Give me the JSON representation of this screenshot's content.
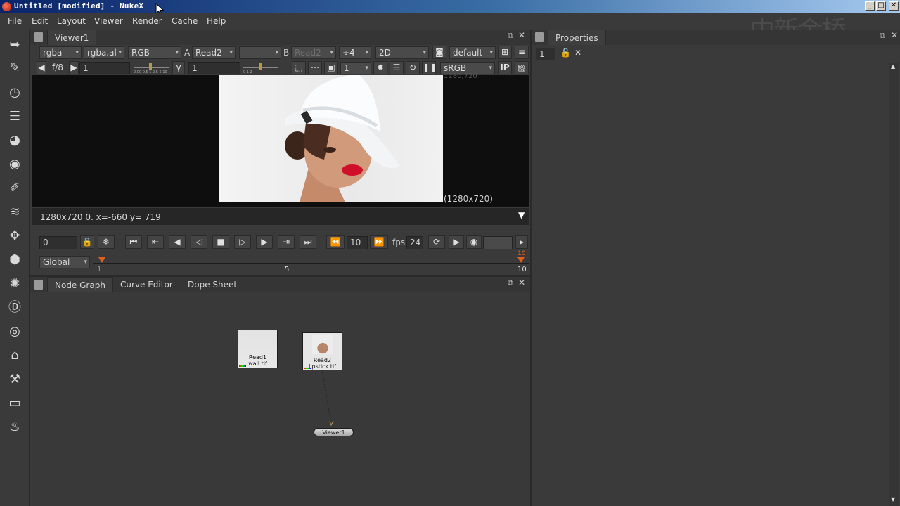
{
  "window": {
    "title": "Untitled [modified] - NukeX",
    "min": "_",
    "max": "□",
    "close": "✕"
  },
  "menu": [
    "File",
    "Edit",
    "Layout",
    "Viewer",
    "Render",
    "Cache",
    "Help"
  ],
  "viewer": {
    "tab": "Viewer1",
    "channels": "rgba",
    "alpha": "rgba.al",
    "display": "RGB",
    "a_label": "A",
    "a_input": "Read2",
    "op": "-",
    "b_label": "B",
    "b_input": "Read2",
    "proxy": "÷4",
    "mode": "2D",
    "lut_default": "default",
    "fstop": "f/8",
    "gain": "1",
    "gamma_label": "γ",
    "gamma": "1",
    "slider_ticks": "0.00 0.5 1 2.5 5 10",
    "gamma_ticks": "0  1  2",
    "downrez": "1",
    "colorspace": "sRGB",
    "ip": "IP",
    "top_label": "1280,720",
    "format_label": "(1280x720)",
    "status": "1280x720 0.  x=-660 y= 719"
  },
  "timeline": {
    "frame": "0",
    "increment": "10",
    "fps_label": "fps",
    "fps": "24",
    "range_mode": "Global",
    "tick_start": "1",
    "tick_mid": "5",
    "tick_end": "10",
    "marker_end": "10"
  },
  "nodegraph": {
    "tabs": [
      "Node Graph",
      "Curve Editor",
      "Dope Sheet"
    ],
    "nodes": [
      {
        "name": "Read1",
        "file": "wall.tif"
      },
      {
        "name": "Read2",
        "file": "lipstick.tif"
      },
      {
        "name": "Viewer1",
        "file": ""
      }
    ]
  },
  "properties": {
    "tab": "Properties",
    "max_panels": "1"
  },
  "watermark": "中新金桥",
  "colors": {
    "titlebar_start": "#0a246a",
    "titlebar_end": "#a6caf0",
    "panel": "#3a3a3a",
    "viewer_bg": "#0e0e0e",
    "accent_orange": "#e06020"
  }
}
